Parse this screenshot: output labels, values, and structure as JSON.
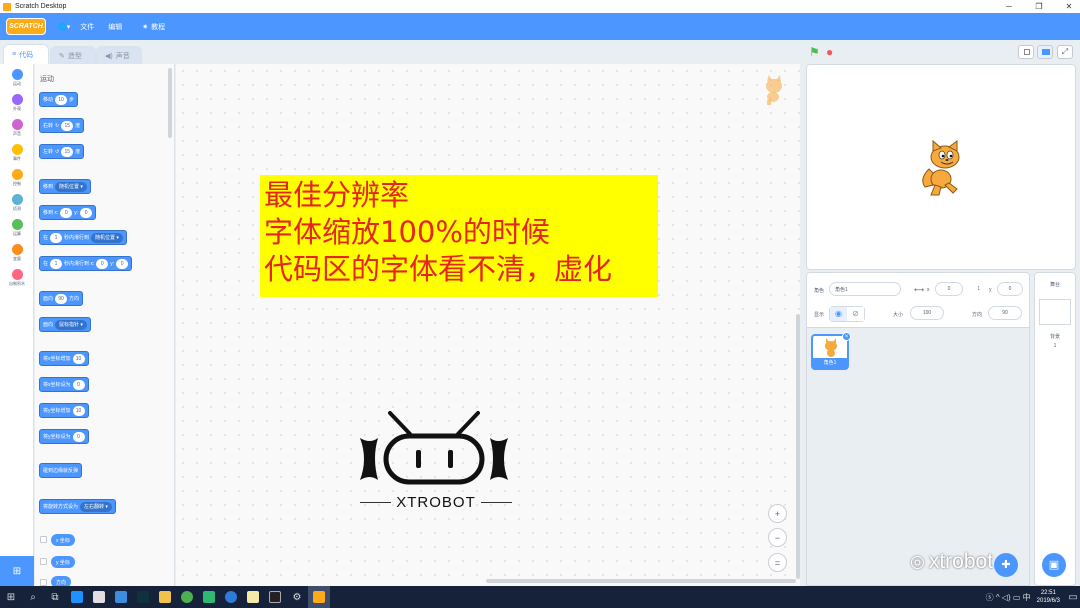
{
  "window": {
    "title": "Scratch Desktop",
    "min": "─",
    "max": "❐",
    "close": "✕"
  },
  "menu": {
    "logo": "SCRATCH",
    "globe": "🌐▾",
    "file": "文件",
    "edit": "编辑",
    "tutorials": "教程"
  },
  "tabs": [
    {
      "label": "代码",
      "icon": "code-icon"
    },
    {
      "label": "造型",
      "icon": "brush-icon"
    },
    {
      "label": "声音",
      "icon": "speaker-icon"
    }
  ],
  "categories": [
    {
      "label": "运动",
      "color": "#4c97ff"
    },
    {
      "label": "外观",
      "color": "#9966ff"
    },
    {
      "label": "声音",
      "color": "#cf63cf"
    },
    {
      "label": "事件",
      "color": "#ffbf00"
    },
    {
      "label": "控制",
      "color": "#ffab19"
    },
    {
      "label": "侦测",
      "color": "#5cb1d6"
    },
    {
      "label": "运算",
      "color": "#59c059"
    },
    {
      "label": "变量",
      "color": "#ff8c1a"
    },
    {
      "label": "自制积木",
      "color": "#ff6680"
    }
  ],
  "palette": {
    "section_title": "运动",
    "move": {
      "a": "移动",
      "v": "10",
      "b": "步"
    },
    "turn_right": {
      "a": "右转",
      "v": "15",
      "b": "度"
    },
    "turn_left": {
      "a": "左转",
      "v": "15",
      "b": "度"
    },
    "goto": {
      "a": "移到",
      "dd": "随机位置 ▾"
    },
    "goto_xy": {
      "a": "移到 x:",
      "x": "0",
      "b": "y:",
      "y": "0"
    },
    "glide": {
      "a": "在",
      "v": "1",
      "b": "秒内滑行到",
      "dd": "随机位置 ▾"
    },
    "glide_xy": {
      "a": "在",
      "v": "1",
      "b": "秒内滑行到 x:",
      "x": "0",
      "c": "y:",
      "y": "0"
    },
    "point_dir": {
      "a": "面向",
      "v": "90",
      "b": "方向"
    },
    "point_to": {
      "a": "面向",
      "dd": "鼠标指针 ▾"
    },
    "change_x": {
      "a": "将x坐标增加",
      "v": "10"
    },
    "set_x": {
      "a": "将x坐标设为",
      "v": "0"
    },
    "change_y": {
      "a": "将y坐标增加",
      "v": "10"
    },
    "set_y": {
      "a": "将y坐标设为",
      "v": "0"
    },
    "bounce": {
      "a": "碰到边缘就反弹"
    },
    "rotation": {
      "a": "将旋转方式设为",
      "dd": "左右翻转 ▾"
    },
    "reporter_x": "x 坐标",
    "reporter_y": "y 坐标",
    "reporter_dir": "方向"
  },
  "overlay": {
    "line1": "最佳分辨率",
    "line2": "字体缩放100%的时候",
    "line3": "代码区的字体看不清，虚化"
  },
  "watermark": {
    "text": "XTROBOT"
  },
  "brand_watermark": "xtrobot",
  "zoom": {
    "in": "+",
    "out": "−",
    "reset": "="
  },
  "stage": {
    "flag": "⚑",
    "stop": "●"
  },
  "sprite_info": {
    "sprite_label": "角色",
    "sprite_name": "角色1",
    "x_label": "x",
    "x": "0",
    "y_label": "y",
    "y": "0",
    "show_label": "显示",
    "size_label": "大小",
    "size": "100",
    "dir_label": "方向",
    "dir": "90"
  },
  "sprites": [
    {
      "name": "角色1"
    }
  ],
  "stage_selector": {
    "title": "舞台",
    "backdrops_label": "背景",
    "backdrops_count": "1"
  },
  "taskbar": {
    "time": "22:51",
    "date": "2019/6/3"
  }
}
